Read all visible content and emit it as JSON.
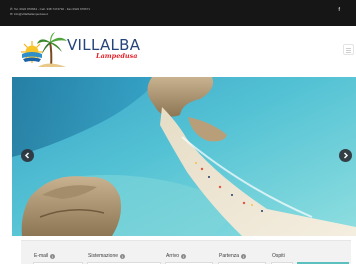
{
  "topbar": {
    "phone_line": "Tel. 0922 970664 - Cell. 338 7474792 - Fax 0922 970671",
    "email_line": "info@villalbalampedusa.it",
    "facebook_icon": "f"
  },
  "header": {
    "brand_name": "VILLALBA",
    "brand_sub": "Lampedusa",
    "logo_icon": "sun-logo-icon",
    "menu_icon": "hamburger-menu-icon"
  },
  "slider": {
    "prev_icon": "chevron-left-icon",
    "next_icon": "chevron-right-icon"
  },
  "booking_form": {
    "fields": [
      {
        "label": "E-mail"
      },
      {
        "label": "Sistemazione"
      },
      {
        "label": "Arrivo"
      },
      {
        "label": "Partenza"
      },
      {
        "label": "Ospiti"
      }
    ],
    "info_icon": "i"
  },
  "colors": {
    "topbar_bg": "#161616",
    "brand_blue": "#25447b",
    "brand_red": "#e0242a",
    "accent_teal": "#5cc1be"
  }
}
